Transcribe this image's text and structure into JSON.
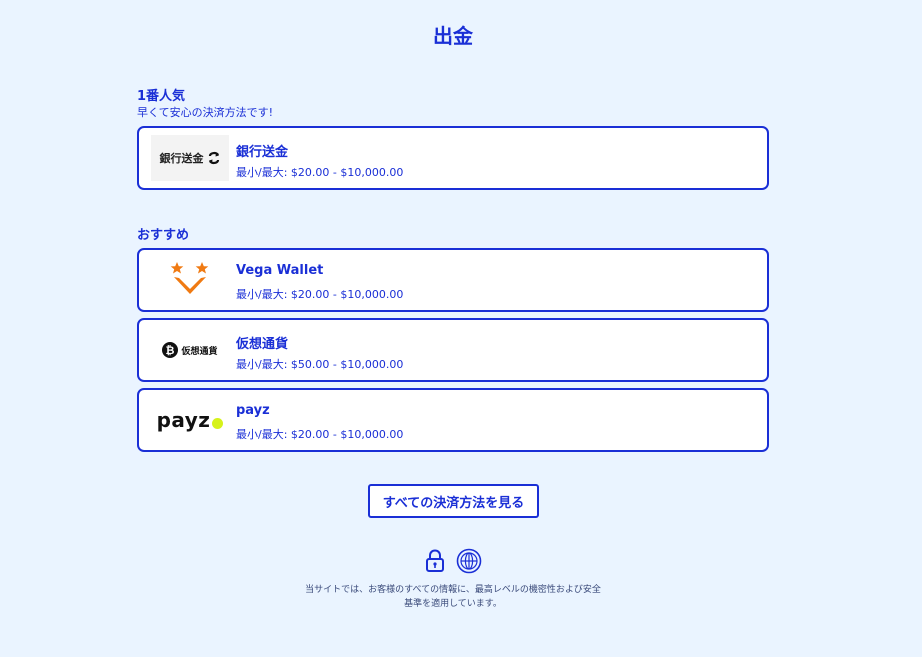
{
  "header": {
    "title": "出金"
  },
  "popular": {
    "title": "1番人気",
    "subtitle": "早くて安心の決済方法です!",
    "methods": [
      {
        "name": "銀行送金",
        "limits": "最小/最大: $20.00 - $10,000.00",
        "logo_text": "銀行送金",
        "icon": "bank-transfer-icon"
      }
    ]
  },
  "recommended": {
    "title": "おすすめ",
    "methods": [
      {
        "name": "Vega Wallet",
        "limits": "最小/最大: $20.00 - $10,000.00",
        "icon": "vega-wallet-logo"
      },
      {
        "name": "仮想通貨",
        "limits": "最小/最大: $50.00 - $10,000.00",
        "logo_text": "仮想通貨",
        "icon": "bitcoin-icon"
      },
      {
        "name": "payz",
        "limits": "最小/最大: $20.00 - $10,000.00",
        "logo_text": "payz",
        "icon": "payz-logo"
      }
    ]
  },
  "actions": {
    "all_methods_label": "すべての決済方法を見る"
  },
  "footer": {
    "note_line1": "当サイトでは、お客様のすべての情報に、最高レベルの機密性および安全",
    "note_line2": "基準を適用しています。",
    "icons": [
      "lock-icon",
      "globe-icon"
    ]
  },
  "colors": {
    "accent": "#1a2fd6",
    "background": "#eaf4ff",
    "card": "#ffffff",
    "vega_orange": "#f07a12",
    "payz_dot": "#d6f21a"
  }
}
